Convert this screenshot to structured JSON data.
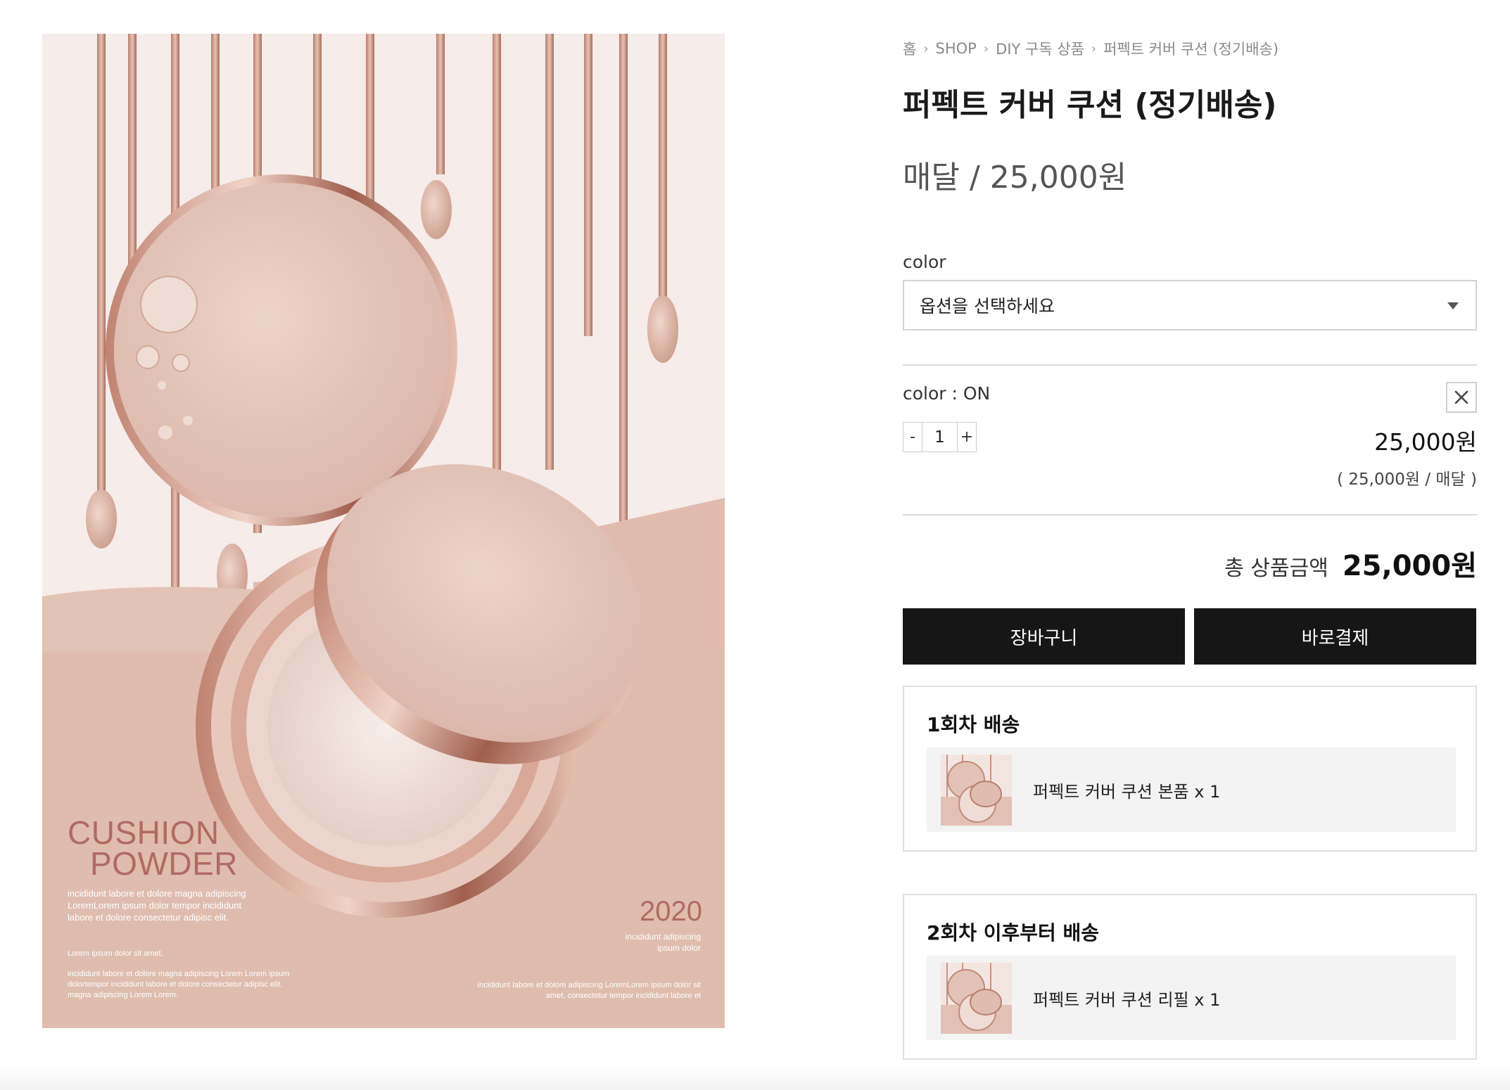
{
  "hero": {
    "title_line1": "CUSHION",
    "title_line2": "POWDER",
    "body": "incididunt labore et dolore magna adipiscing LoremLorem ipsum dolor tempor incididunt labore et dolore consectetur adipisc elit.",
    "sub": "Lorem ipsum dolor sit amet,",
    "body2": "incididunt labore et dolore magna adipiscing Lorem Lorem ipsum dolortempor incididunt labore et dolore consectetur adipisc elit. magna adipiscing Lorem Lorem.",
    "year": "2020",
    "year_sub": "incididunt adipiscing ipsum dolor",
    "body3": "incididunt labore et dolore adipiscing LoremLorem ipsum dolor sit amet, consectetur tempor incididunt labore et",
    "colors": {
      "background": "#f6ecea",
      "rose": "#d9b0a3",
      "accent": "#b06a62"
    }
  },
  "breadcrumb": {
    "home": "홈",
    "shop": "SHOP",
    "category": "DIY 구독 상품",
    "current": "퍼펙트 커버 쿠션 (정기배송)",
    "separator_icon": "chevron-right-icon"
  },
  "product": {
    "title": "퍼펙트 커버 쿠션 (정기배송)",
    "price": "매달 / 25,000원"
  },
  "option": {
    "label": "color",
    "select_value": "옵션을 선택하세요",
    "caret_icon": "caret-down-icon"
  },
  "selected": {
    "label": "color : ON",
    "remove_icon": "close-icon",
    "minus": "-",
    "qty": "1",
    "plus": "+",
    "price": "25,000원",
    "sub_price": "( 25,000원 / 매달 )"
  },
  "total": {
    "label": "총 상품금액",
    "value": "25,000원"
  },
  "actions": {
    "cart": "장바구니",
    "buy": "바로결제",
    "button_color": "#161616"
  },
  "shipping": [
    {
      "title": "1회차 배송",
      "item": "퍼펙트 커버 쿠션 본품 x 1"
    },
    {
      "title": "2회차 이후부터 배송",
      "item": "퍼펙트 커버 쿠션 리필 x 1"
    }
  ]
}
